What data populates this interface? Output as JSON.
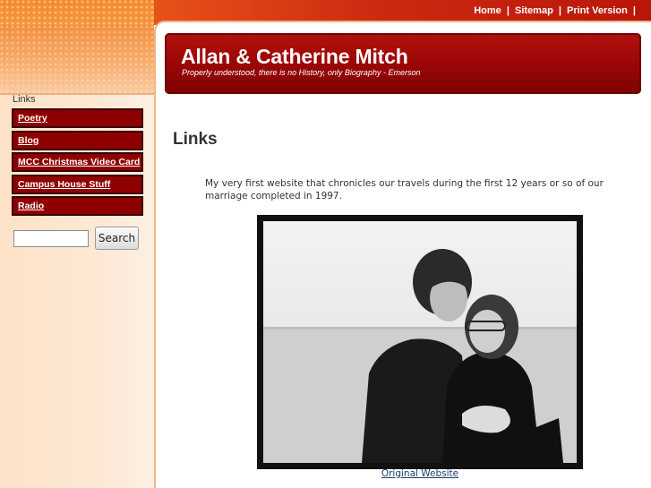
{
  "utility_nav": {
    "home": "Home",
    "sitemap": "Sitemap",
    "print_version": "Print Version",
    "separator": "|"
  },
  "header": {
    "site_title": "Allan & Catherine Mitch",
    "tagline": "Properly understood, there is no History, only Biography - Emerson"
  },
  "sidebar": {
    "section_title": "Links",
    "items": [
      {
        "label": "Poetry"
      },
      {
        "label": "Blog"
      },
      {
        "label": "MCC Christmas Video Card"
      },
      {
        "label": "Campus House Stuff"
      },
      {
        "label": "Radio"
      }
    ],
    "search": {
      "placeholder": "",
      "value": "",
      "button_label": "Search"
    }
  },
  "main": {
    "page_title": "Links",
    "intro_text": "My very first website that chronicles our travels during the first 12 years or so of our marriage completed in 1997.",
    "photo_alt": "couple-photo",
    "photo_link_label": "Original Website"
  },
  "colors": {
    "accent_red": "#990606",
    "nav_red": "#8e0000",
    "orange": "#f47a1e",
    "link_blue": "#1f3c6e"
  }
}
